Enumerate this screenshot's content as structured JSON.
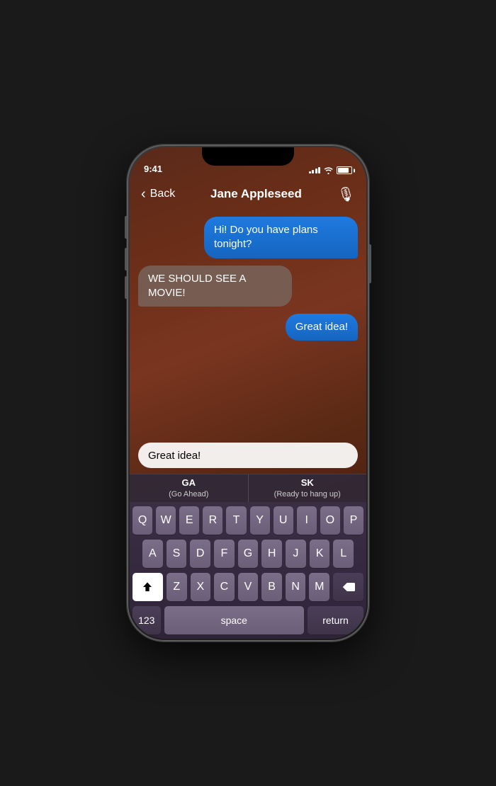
{
  "phone": {
    "status_bar": {
      "time": "9:41",
      "signal_bars": [
        3,
        5,
        7,
        9,
        11
      ],
      "battery_level": 85
    },
    "nav": {
      "back_label": "Back",
      "title": "Jane Appleseed",
      "mic_icon": "🎙"
    },
    "messages": [
      {
        "id": "msg1",
        "text": "Hi! Do you have plans tonight?",
        "direction": "outgoing"
      },
      {
        "id": "msg2",
        "text": "WE SHOULD SEE A MOVIE!",
        "direction": "incoming"
      },
      {
        "id": "msg3",
        "text": "Great idea!",
        "direction": "outgoing"
      }
    ],
    "input": {
      "value": "Great idea!",
      "placeholder": ""
    },
    "autocomplete": [
      {
        "abbr": "GA",
        "expansion": "(Go Ahead)"
      },
      {
        "abbr": "SK",
        "expansion": "(Ready to hang up)"
      }
    ],
    "keyboard": {
      "rows": [
        [
          "Q",
          "W",
          "E",
          "R",
          "T",
          "Y",
          "U",
          "I",
          "O",
          "P"
        ],
        [
          "A",
          "S",
          "D",
          "F",
          "G",
          "H",
          "J",
          "K",
          "L"
        ],
        [
          "Z",
          "X",
          "C",
          "V",
          "B",
          "N",
          "M"
        ]
      ],
      "bottom": {
        "num_label": "123",
        "space_label": "space",
        "return_label": "return"
      }
    }
  }
}
